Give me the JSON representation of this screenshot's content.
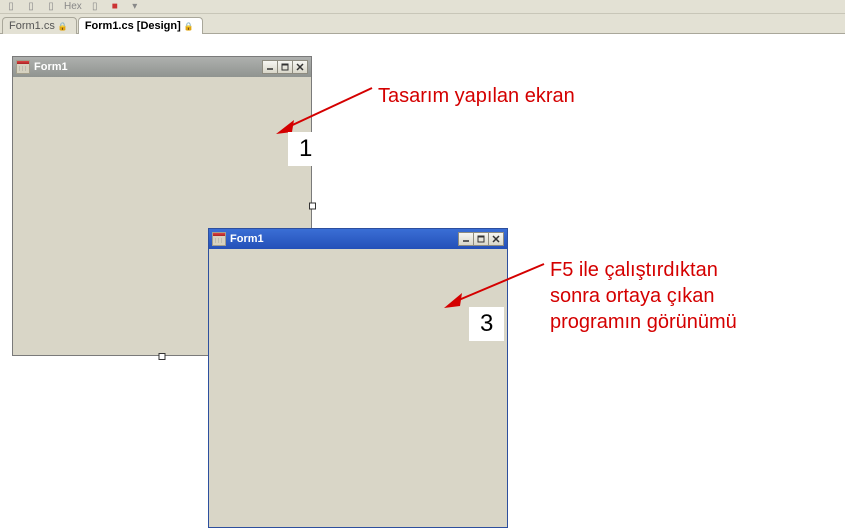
{
  "toolbar": {
    "hex_label": "Hex"
  },
  "tabs": {
    "items": [
      {
        "label": "Form1.cs"
      },
      {
        "label": "Form1.cs [Design]"
      }
    ]
  },
  "form_design": {
    "title": "Form1",
    "min_label": "_",
    "max_label": "□",
    "close_label": "X"
  },
  "form_run": {
    "title": "Form1",
    "min_label": "_",
    "max_label": "□",
    "close_label": "X"
  },
  "annotations": {
    "a1_text": "Tasarım yapılan ekran",
    "a1_num": "1",
    "a2_text_l1": "F5 ile çalıştırdıktan",
    "a2_text_l2": "sonra ortaya çıkan",
    "a2_text_l3": "programın görünümü",
    "a2_num": "3"
  }
}
